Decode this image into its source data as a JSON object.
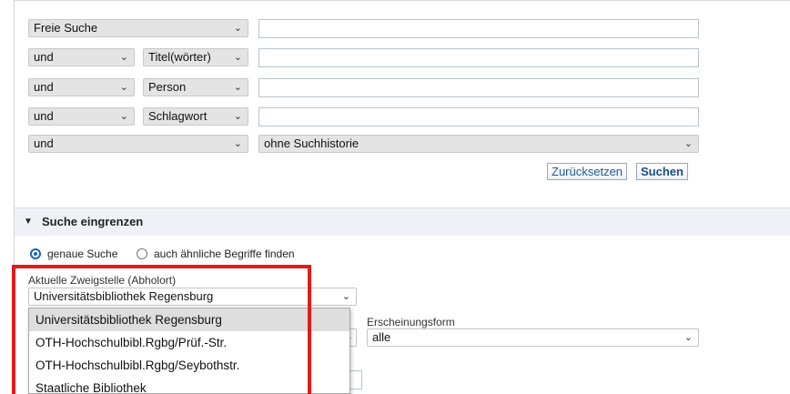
{
  "search_rows": {
    "row1": {
      "field": "Freie Suche"
    },
    "row2": {
      "operator": "und",
      "field": "Titel(wörter)"
    },
    "row3": {
      "operator": "und",
      "field": "Person"
    },
    "row4": {
      "operator": "und",
      "field": "Schlagwort"
    },
    "row5": {
      "operator": "und",
      "history": "ohne Suchhistorie"
    }
  },
  "buttons": {
    "reset": "Zurücksetzen",
    "search": "Suchen"
  },
  "refine": {
    "title": "Suche eingrenzen",
    "radio_exact": "genaue Suche",
    "radio_similar": "auch ähnliche Begriffe finden",
    "branch_label": "Aktuelle Zweigstelle (Abholort)",
    "branch_selected": "Universitätsbibliothek Regensburg",
    "branch_options": [
      "Universitätsbibliothek Regensburg",
      "OTH-Hochschulbibl.Rgbg/Prüf.-Str.",
      "OTH-Hochschulbibl.Rgbg/Seybothstr.",
      "Staatliche Bibliothek"
    ],
    "pubform_label": "Erscheinungsform",
    "pubform_value": "alle"
  },
  "icons": {
    "chevron": "chevron-down-icon",
    "triangle": "triangle-down-icon"
  },
  "colors": {
    "highlight": "#e21b1b",
    "radio_accent": "#1565c0"
  }
}
